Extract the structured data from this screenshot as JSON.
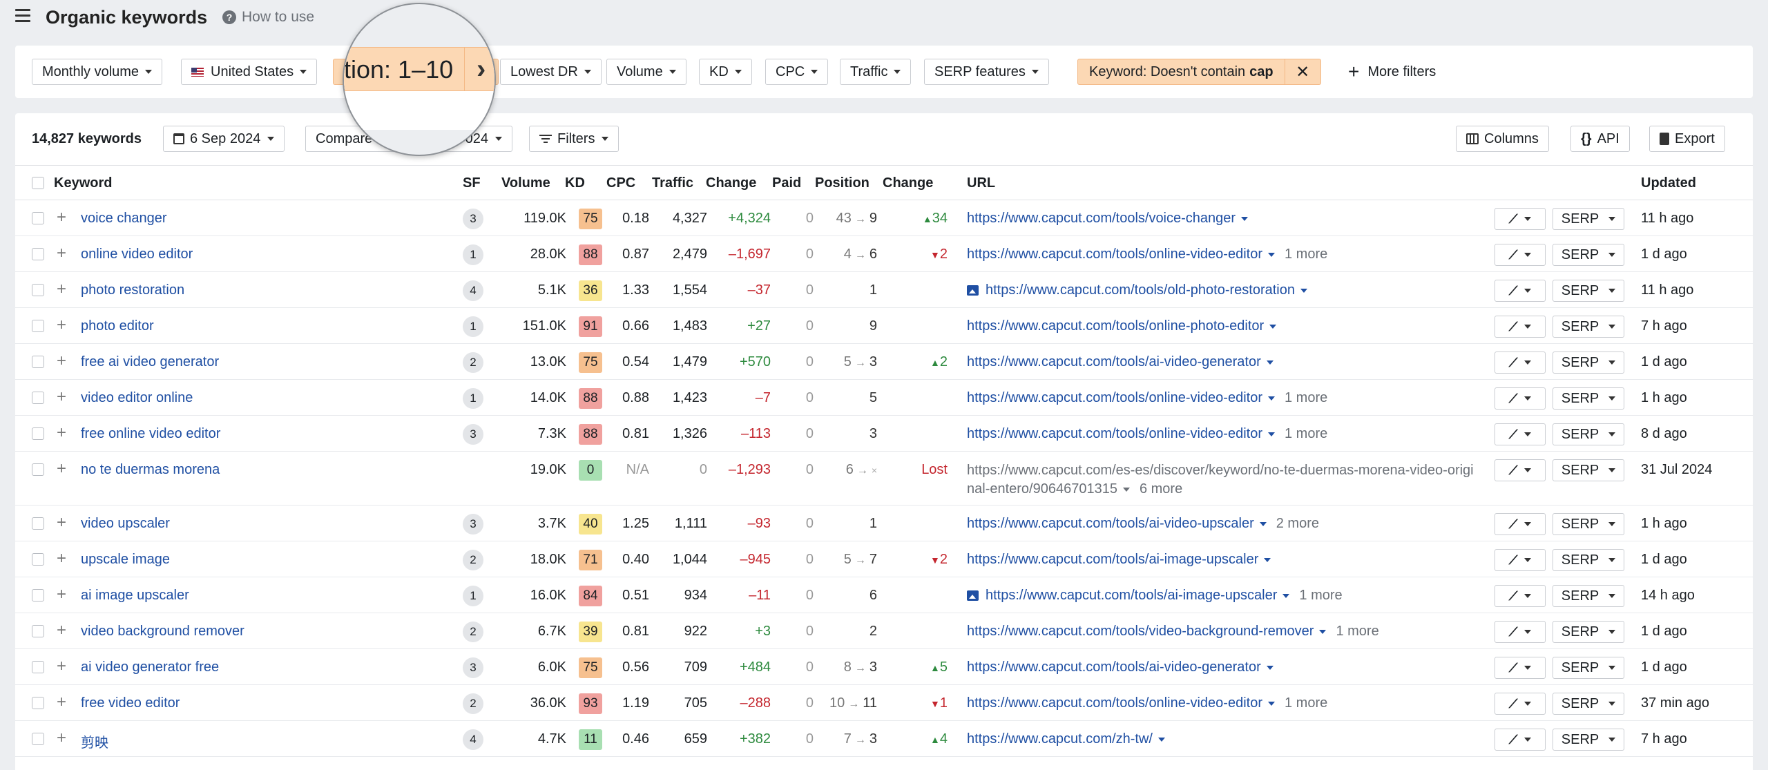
{
  "header": {
    "title": "Organic keywords",
    "how_to_use": "How to use"
  },
  "filters": {
    "monthly_volume": "Monthly volume",
    "country": "United States",
    "position_chip": "tion: 1–10",
    "lowest_dr": "Lowest DR",
    "volume": "Volume",
    "kd": "KD",
    "cpc": "CPC",
    "traffic": "Traffic",
    "serp_features": "SERP features",
    "keyword_filter_prefix": "Keyword: Doesn't contain",
    "keyword_filter_value": "cap",
    "more_filters": "More filters"
  },
  "toolbar": {
    "count": "14,827 keywords",
    "date": "6 Sep 2024",
    "compare": "Compare",
    "compare_date": "024",
    "filters": "Filters",
    "columns": "Columns",
    "api": "API",
    "export": "Export"
  },
  "columns": {
    "keyword": "Keyword",
    "sf": "SF",
    "volume": "Volume",
    "kd": "KD",
    "cpc": "CPC",
    "traffic": "Traffic",
    "change": "Change",
    "paid": "Paid",
    "position": "Position",
    "pos_change": "Change",
    "url": "URL",
    "updated": "Updated"
  },
  "serp_label": "SERP",
  "colors": {
    "kd_green": "#a8dfb2",
    "kd_yellow": "#f7e58f",
    "kd_orange": "#f6c08f",
    "kd_red": "#f0a19e"
  },
  "rows": [
    {
      "keyword": "voice changer",
      "sf": "3",
      "volume": "119.0K",
      "kd": "75",
      "kd_color": "#f6c08f",
      "cpc": "0.18",
      "traffic": "4,327",
      "change": "+4,324",
      "paid": "0",
      "pos_from": "43",
      "pos_to": "9",
      "pos_change": "34",
      "pos_dir": "up",
      "url": "https://www.capcut.com/tools/voice-changer",
      "more": "",
      "img": false,
      "updated": "11 h ago"
    },
    {
      "keyword": "online video editor",
      "sf": "1",
      "volume": "28.0K",
      "kd": "88",
      "kd_color": "#f0a19e",
      "cpc": "0.87",
      "traffic": "2,479",
      "change": "–1,697",
      "paid": "0",
      "pos_from": "4",
      "pos_to": "6",
      "pos_change": "2",
      "pos_dir": "down",
      "url": "https://www.capcut.com/tools/online-video-editor",
      "more": "1 more",
      "img": false,
      "updated": "1 d ago"
    },
    {
      "keyword": "photo restoration",
      "sf": "4",
      "volume": "5.1K",
      "kd": "36",
      "kd_color": "#f7e58f",
      "cpc": "1.33",
      "traffic": "1,554",
      "change": "–37",
      "paid": "0",
      "pos_from": "",
      "pos_to": "1",
      "pos_change": "",
      "pos_dir": "",
      "url": "https://www.capcut.com/tools/old-photo-restoration",
      "more": "",
      "img": true,
      "updated": "11 h ago"
    },
    {
      "keyword": "photo editor",
      "sf": "1",
      "volume": "151.0K",
      "kd": "91",
      "kd_color": "#f0a19e",
      "cpc": "0.66",
      "traffic": "1,483",
      "change": "+27",
      "paid": "0",
      "pos_from": "",
      "pos_to": "9",
      "pos_change": "",
      "pos_dir": "",
      "url": "https://www.capcut.com/tools/online-photo-editor",
      "more": "",
      "img": false,
      "updated": "7 h ago"
    },
    {
      "keyword": "free ai video generator",
      "sf": "2",
      "volume": "13.0K",
      "kd": "75",
      "kd_color": "#f6c08f",
      "cpc": "0.54",
      "traffic": "1,479",
      "change": "+570",
      "paid": "0",
      "pos_from": "5",
      "pos_to": "3",
      "pos_change": "2",
      "pos_dir": "up",
      "url": "https://www.capcut.com/tools/ai-video-generator",
      "more": "",
      "img": false,
      "updated": "1 d ago"
    },
    {
      "keyword": "video editor online",
      "sf": "1",
      "volume": "14.0K",
      "kd": "88",
      "kd_color": "#f0a19e",
      "cpc": "0.88",
      "traffic": "1,423",
      "change": "–7",
      "paid": "0",
      "pos_from": "",
      "pos_to": "5",
      "pos_change": "",
      "pos_dir": "",
      "url": "https://www.capcut.com/tools/online-video-editor",
      "more": "1 more",
      "img": false,
      "updated": "1 h ago"
    },
    {
      "keyword": "free online video editor",
      "sf": "3",
      "volume": "7.3K",
      "kd": "88",
      "kd_color": "#f0a19e",
      "cpc": "0.81",
      "traffic": "1,326",
      "change": "–113",
      "paid": "0",
      "pos_from": "",
      "pos_to": "3",
      "pos_change": "",
      "pos_dir": "",
      "url": "https://www.capcut.com/tools/online-video-editor",
      "more": "1 more",
      "img": false,
      "updated": "8 d ago"
    },
    {
      "keyword": "no te duermas morena",
      "sf": "",
      "volume": "19.0K",
      "kd": "0",
      "kd_color": "#a8dfb2",
      "cpc": "N/A",
      "traffic": "0",
      "change": "–1,293",
      "paid": "0",
      "pos_from": "6",
      "pos_to": "×",
      "pos_change": "Lost",
      "pos_dir": "lost",
      "url": "https://www.capcut.com/es-es/discover/keyword/no-te-duermas-morena-video-original-entero/90646701315",
      "more": "6 more",
      "img": false,
      "updated": "31 Jul 2024"
    },
    {
      "keyword": "video upscaler",
      "sf": "3",
      "volume": "3.7K",
      "kd": "40",
      "kd_color": "#f7e58f",
      "cpc": "1.25",
      "traffic": "1,111",
      "change": "–93",
      "paid": "0",
      "pos_from": "",
      "pos_to": "1",
      "pos_change": "",
      "pos_dir": "",
      "url": "https://www.capcut.com/tools/ai-video-upscaler",
      "more": "2 more",
      "img": false,
      "updated": "1 h ago"
    },
    {
      "keyword": "upscale image",
      "sf": "2",
      "volume": "18.0K",
      "kd": "71",
      "kd_color": "#f6c08f",
      "cpc": "0.40",
      "traffic": "1,044",
      "change": "–945",
      "paid": "0",
      "pos_from": "5",
      "pos_to": "7",
      "pos_change": "2",
      "pos_dir": "down",
      "url": "https://www.capcut.com/tools/ai-image-upscaler",
      "more": "",
      "img": false,
      "updated": "1 d ago"
    },
    {
      "keyword": "ai image upscaler",
      "sf": "1",
      "volume": "16.0K",
      "kd": "84",
      "kd_color": "#f0a19e",
      "cpc": "0.51",
      "traffic": "934",
      "change": "–11",
      "paid": "0",
      "pos_from": "",
      "pos_to": "6",
      "pos_change": "",
      "pos_dir": "",
      "url": "https://www.capcut.com/tools/ai-image-upscaler",
      "more": "1 more",
      "img": true,
      "updated": "14 h ago"
    },
    {
      "keyword": "video background remover",
      "sf": "2",
      "volume": "6.7K",
      "kd": "39",
      "kd_color": "#f7e58f",
      "cpc": "0.81",
      "traffic": "922",
      "change": "+3",
      "paid": "0",
      "pos_from": "",
      "pos_to": "2",
      "pos_change": "",
      "pos_dir": "",
      "url": "https://www.capcut.com/tools/video-background-remover",
      "more": "1 more",
      "img": false,
      "updated": "1 d ago"
    },
    {
      "keyword": "ai video generator free",
      "sf": "3",
      "volume": "6.0K",
      "kd": "75",
      "kd_color": "#f6c08f",
      "cpc": "0.56",
      "traffic": "709",
      "change": "+484",
      "paid": "0",
      "pos_from": "8",
      "pos_to": "3",
      "pos_change": "5",
      "pos_dir": "up",
      "url": "https://www.capcut.com/tools/ai-video-generator",
      "more": "",
      "img": false,
      "updated": "1 d ago"
    },
    {
      "keyword": "free video editor",
      "sf": "2",
      "volume": "36.0K",
      "kd": "93",
      "kd_color": "#f0a19e",
      "cpc": "1.19",
      "traffic": "705",
      "change": "–288",
      "paid": "0",
      "pos_from": "10",
      "pos_to": "11",
      "pos_change": "1",
      "pos_dir": "down",
      "url": "https://www.capcut.com/tools/online-video-editor",
      "more": "1 more",
      "img": false,
      "updated": "37 min ago"
    },
    {
      "keyword": "剪映",
      "sf": "4",
      "volume": "4.7K",
      "kd": "11",
      "kd_color": "#a8dfb2",
      "cpc": "0.46",
      "traffic": "659",
      "change": "+382",
      "paid": "0",
      "pos_from": "7",
      "pos_to": "3",
      "pos_change": "4",
      "pos_dir": "up",
      "url": "https://www.capcut.com/zh-tw/",
      "more": "",
      "img": false,
      "updated": "7 h ago"
    }
  ]
}
